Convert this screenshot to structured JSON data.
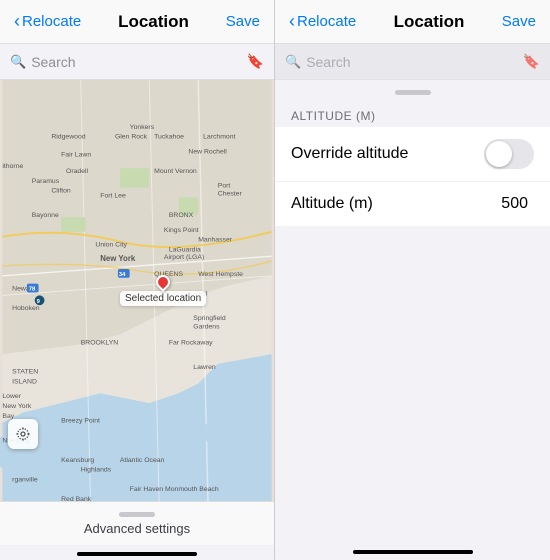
{
  "left": {
    "nav": {
      "back_label": "Relocate",
      "title": "Location",
      "save_label": "Save"
    },
    "search": {
      "placeholder": "Search",
      "bookmark_icon": "📖"
    },
    "map": {
      "selected_location_label": "Selected location"
    },
    "bottom": {
      "handle_visible": true,
      "advanced_settings_label": "Advanced settings"
    }
  },
  "right": {
    "nav": {
      "back_label": "Relocate",
      "title": "Location",
      "save_label": "Save"
    },
    "search": {
      "placeholder": "Search"
    },
    "altitude_section": {
      "header": "ALTITUDE (M)",
      "override_label": "Override altitude",
      "override_value": false,
      "altitude_label": "Altitude (m)",
      "altitude_value": "500"
    }
  }
}
